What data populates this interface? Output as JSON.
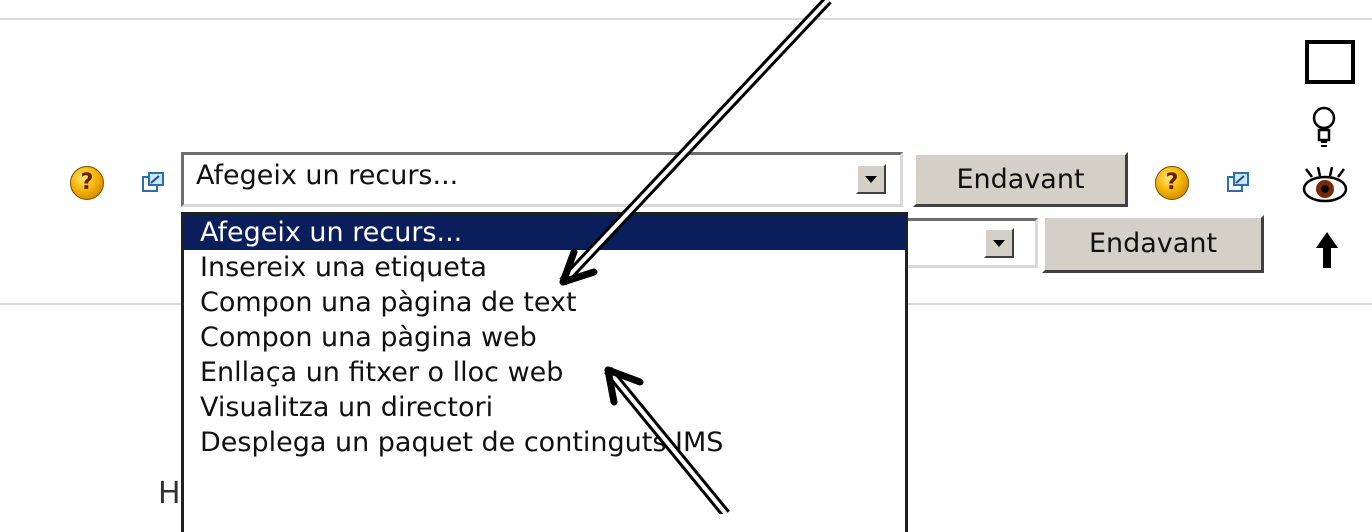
{
  "row1": {
    "select_value": "Afegeix un recurs...",
    "go_button": "Endavant"
  },
  "row2": {
    "go_button": "Endavant"
  },
  "dropdown": {
    "options": [
      "Afegeix un recurs...",
      "Insereix una etiqueta",
      "Compon una pàgina de text",
      "Compon una pàgina web",
      "Enllaça un fitxer o lloc web",
      "Visualitza un directori",
      "Desplega un paquet de continguts IMS"
    ],
    "selected_index": 0
  },
  "help_glyph": "?",
  "stray_text": "H",
  "icons": [
    "help-icon",
    "popup-window-icon",
    "square-icon",
    "lightbulb-icon",
    "eye-icon",
    "up-arrow-icon"
  ],
  "colors": {
    "selection": "#0a1e5c",
    "button_face": "#d4d0c8"
  }
}
